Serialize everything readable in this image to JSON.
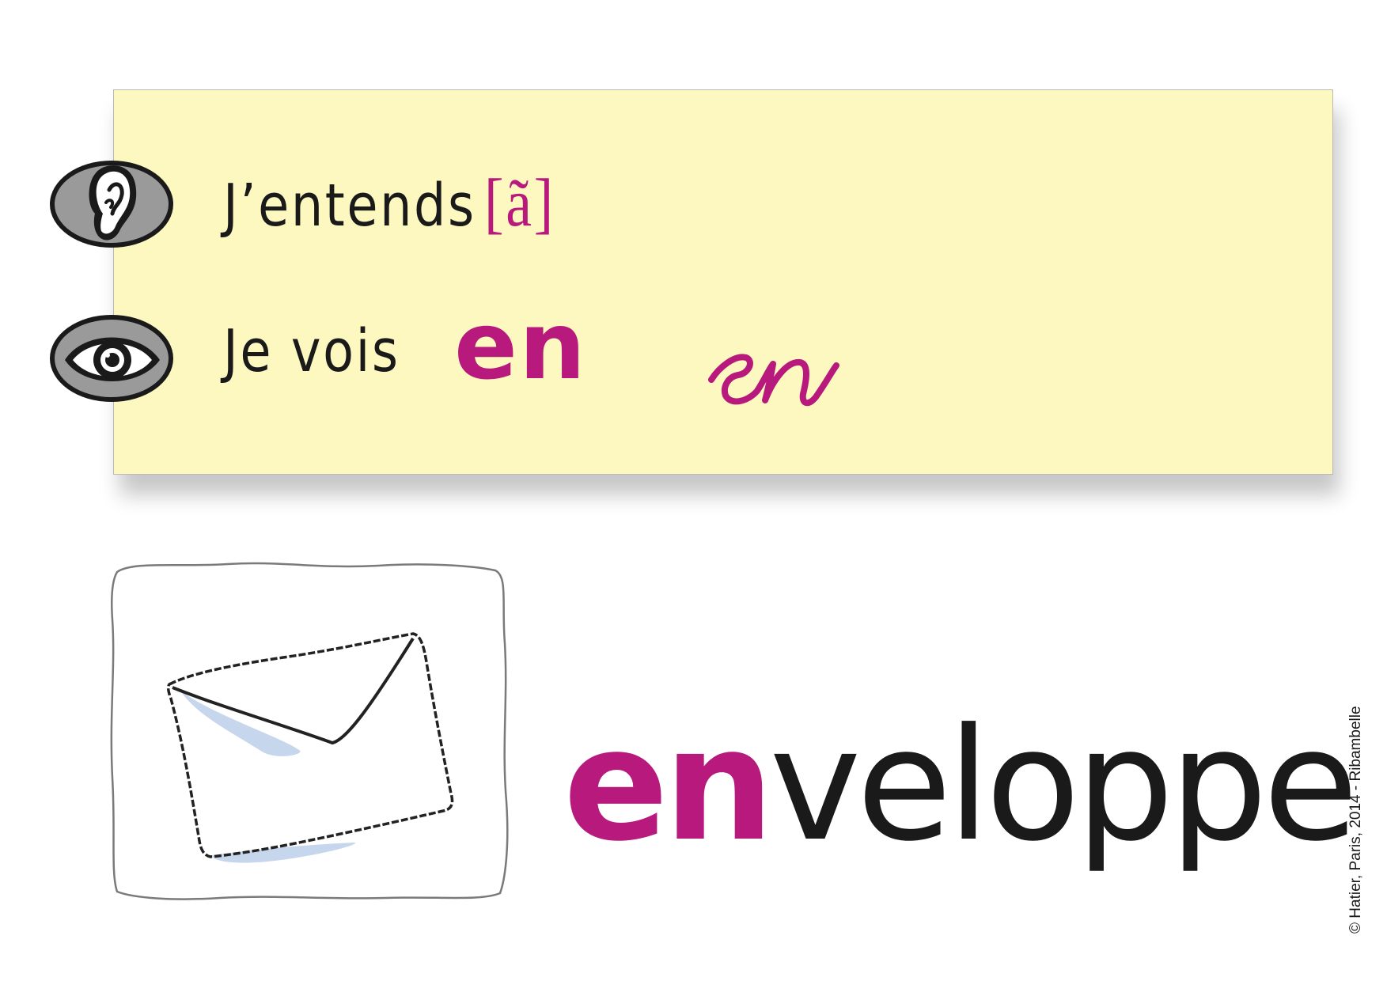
{
  "card": {
    "hear_label": "J’entends",
    "phoneme": "[ã]",
    "see_label": "Je vois",
    "grapheme_print": "en",
    "grapheme_cursive": "en"
  },
  "example": {
    "word_highlight": "en",
    "word_rest": "veloppe"
  },
  "copyright": "© Hatier, Paris, 2014 - Ribambelle",
  "colors": {
    "accent": "#b8197d",
    "card_background": "#fdf8bf",
    "text": "#1a1a1a"
  },
  "icons": {
    "hear": "ear-icon",
    "see": "eye-icon",
    "picture": "envelope-icon"
  }
}
